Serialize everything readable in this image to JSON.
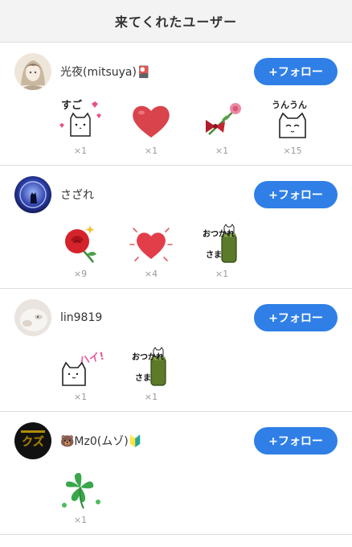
{
  "header": {
    "title": "来てくれたユーザー"
  },
  "users": [
    {
      "name": "光夜(mitsuya)🎴",
      "follow_label": "+フォロー",
      "stamps": [
        {
          "icon": "sugoi-cat-sticker",
          "count": "×1"
        },
        {
          "icon": "red-heart-sticker",
          "count": "×1"
        },
        {
          "icon": "rose-ribbon-sticker",
          "count": "×1"
        },
        {
          "icon": "unun-cat-sticker",
          "count": "×15"
        }
      ]
    },
    {
      "name": "さざれ",
      "follow_label": "+フォロー",
      "stamps": [
        {
          "icon": "red-rose-sticker",
          "count": "×9"
        },
        {
          "icon": "sparkle-heart-sticker",
          "count": "×4"
        },
        {
          "icon": "otsukaresama-cat-sticker",
          "count": "×1"
        }
      ]
    },
    {
      "name": "lin9819",
      "follow_label": "+フォロー",
      "stamps": [
        {
          "icon": "hai-cat-sticker",
          "count": "×1"
        },
        {
          "icon": "otsukaresama-cat-sticker",
          "count": "×1"
        }
      ]
    },
    {
      "name": "🐻Mz0(ムゾ)🔰",
      "follow_label": "+フォロー",
      "stamps": [
        {
          "icon": "four-leaf-clover-sticker",
          "count": "×1"
        }
      ]
    }
  ],
  "sticker_text": {
    "sugoi": "すご",
    "unun": "うんうん",
    "otsukare_1": "おつかれ",
    "otsukare_2": "さま",
    "hai": "ハイ!"
  },
  "avatar_text": {
    "mz0": "クズ"
  },
  "colors": {
    "follow_button": "#2f7fe6",
    "heart": "#d9434b",
    "rose": "#d4232a",
    "clover": "#3aa64a"
  }
}
